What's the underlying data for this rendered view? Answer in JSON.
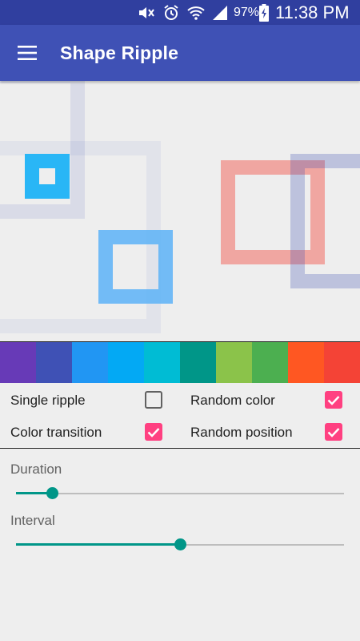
{
  "status_bar": {
    "battery_percent": "97%",
    "time": "11:38 PM",
    "icons": [
      "mute-icon",
      "alarm-icon",
      "wifi-icon",
      "signal-icon",
      "battery-charging-icon"
    ]
  },
  "app_bar": {
    "title": "Shape Ripple",
    "menu_icon": "hamburger-menu-icon"
  },
  "palette": {
    "colors": [
      "#673ab7",
      "#3f51b5",
      "#2196f3",
      "#03a9f4",
      "#00bcd4",
      "#009688",
      "#8bc34a",
      "#4caf50",
      "#ff5722",
      "#f44336"
    ]
  },
  "options": {
    "single_ripple": {
      "label": "Single ripple",
      "checked": false
    },
    "random_color": {
      "label": "Random color",
      "checked": true
    },
    "color_transition": {
      "label": "Color transition",
      "checked": true
    },
    "random_position": {
      "label": "Random position",
      "checked": true
    }
  },
  "sliders": {
    "duration": {
      "label": "Duration",
      "value_fraction": 0.11
    },
    "interval": {
      "label": "Interval",
      "value_fraction": 0.5
    }
  },
  "colors": {
    "status_bar": "#303f9f",
    "app_bar": "#3f51b5",
    "accent_pink": "#ff4081",
    "slider_teal": "#009688"
  }
}
